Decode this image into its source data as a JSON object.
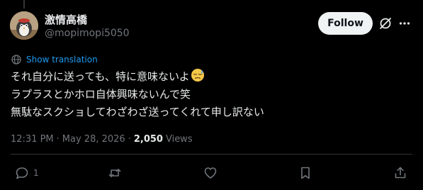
{
  "author": {
    "name": "激情高橋",
    "handle": "@mopimopi5050"
  },
  "header": {
    "follow_label": "Follow"
  },
  "translation": {
    "label": "Show translation"
  },
  "tweet": {
    "lines": [
      "それ自分に送っても、特に意味ないよ",
      "ラプラスとかホロ自体興味ないんで笑",
      "無駄なスクショしてわざわざ送ってくれて申し訳ない"
    ],
    "emoji": "downcast-face-with-sweat"
  },
  "meta": {
    "time": "12:31 PM",
    "separator": "·",
    "date": "May 28, 2026",
    "views_count": "2,050",
    "views_label": "Views"
  },
  "actions": {
    "reply_count": "1"
  },
  "colors": {
    "background": "#000000",
    "text": "#e7e9ea",
    "muted": "#71767b",
    "link": "#1d9bf0",
    "follow_bg": "#eff3f4",
    "divider": "#2f3336"
  },
  "icons": [
    "avatar",
    "grok-icon",
    "more-icon",
    "translate-icon",
    "reply-icon",
    "retweet-icon",
    "like-icon",
    "bookmark-icon",
    "share-icon"
  ]
}
